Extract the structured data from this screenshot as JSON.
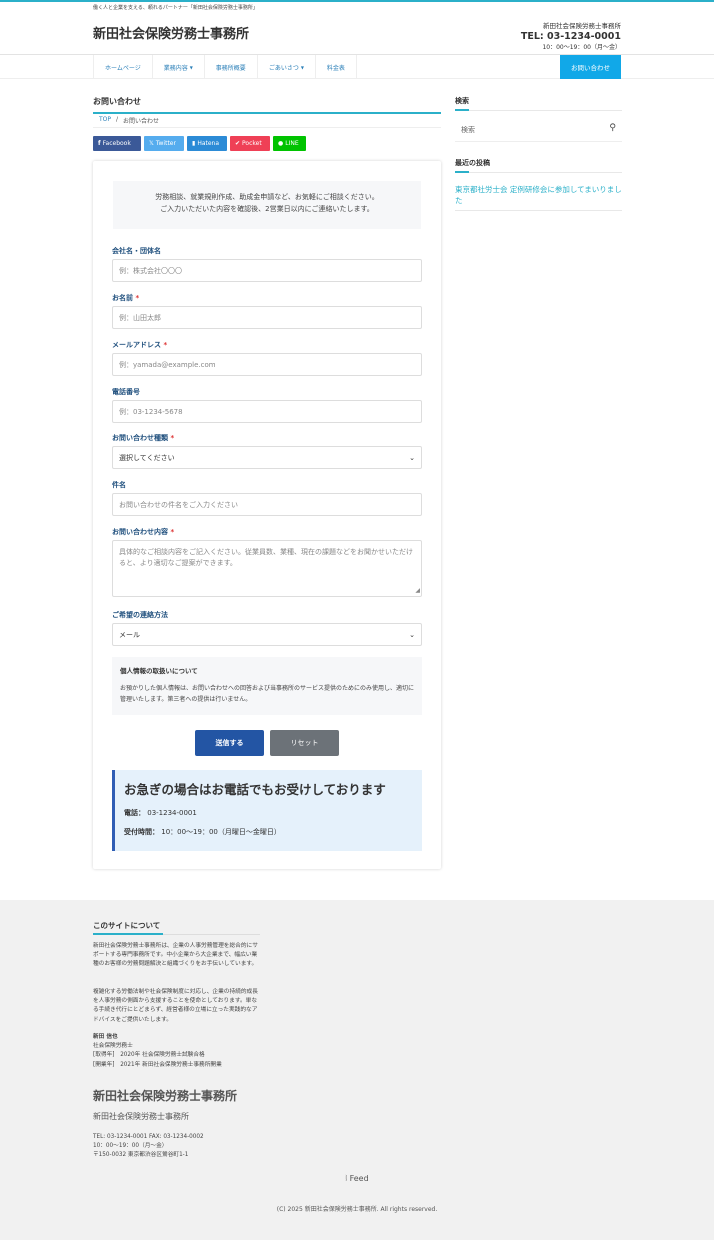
{
  "tagline": "働く人と企業を支える、頼れるパートナー「新田社会保険労務士事務所」",
  "header": {
    "site_title": "新田社会保険労務士事務所",
    "office_name": "新田社会保険労務士事務所",
    "tel": "TEL: 03-1234-0001",
    "hours": "10：00〜19：00（月〜金）"
  },
  "nav": {
    "items": [
      {
        "label": "ホームページ",
        "caret": ""
      },
      {
        "label": "業務内容",
        "caret": "▼"
      },
      {
        "label": "事務所概要",
        "caret": ""
      },
      {
        "label": "ごあいさつ",
        "caret": "▼"
      },
      {
        "label": "料金表",
        "caret": ""
      }
    ],
    "cta": "お問い合わせ"
  },
  "page": {
    "title": "お問い合わせ",
    "breadcrumb": {
      "top": "TOP",
      "sep": "/",
      "current": "お問い合わせ"
    }
  },
  "share": {
    "facebook": "Facebook",
    "twitter": "Twitter",
    "hatena": "Hatena",
    "pocket": "Pocket",
    "line": "LINE"
  },
  "form": {
    "intro_line1": "労務相談、就業規則作成、助成金申請など、お気軽にご相談ください。",
    "intro_line2": "ご入力いただいた内容を確認後、2営業日以内にご連絡いたします。",
    "required_mark": "*",
    "company": {
      "label": "会社名・団体名",
      "placeholder": "例：株式会社〇〇〇"
    },
    "name": {
      "label": "お名前",
      "placeholder": "例：山田太郎"
    },
    "email": {
      "label": "メールアドレス",
      "placeholder": "例：yamada@example.com"
    },
    "phone": {
      "label": "電話番号",
      "placeholder": "例：03-1234-5678"
    },
    "type": {
      "label": "お問い合わせ種類",
      "value": "選択してください"
    },
    "subject": {
      "label": "件名",
      "placeholder": "お問い合わせの件名をご入力ください"
    },
    "content": {
      "label": "お問い合わせ内容",
      "placeholder": "具体的なご相談内容をご記入ください。従業員数、業種、現在の課題などをお聞かせいただけると、より適切なご提案ができます。"
    },
    "contact_method": {
      "label": "ご希望の連絡方法",
      "value": "メール"
    },
    "privacy": {
      "title": "個人情報の取扱いについて",
      "text": "お預かりした個人情報は、お問い合わせへの回答および当事務所のサービス提供のためにのみ使用し、適切に管理いたします。第三者への提供は行いません。"
    },
    "submit": "送信する",
    "reset": "リセット"
  },
  "urgent": {
    "title": "お急ぎの場合はお電話でもお受けしております",
    "tel_label": "電話：",
    "tel": "03-1234-0001",
    "hours_label": "受付時間：",
    "hours": "10：00〜19：00（月曜日〜金曜日）"
  },
  "sidebar": {
    "search_heading": "検索",
    "search_placeholder": "検索",
    "recent_heading": "最近の投稿",
    "recent_post": "東京都社労士会 定例研修会に参加してまいりました"
  },
  "footer": {
    "about_heading": "このサイトについて",
    "about_p1": "新田社会保険労務士事務所は、企業の人事労務管理を総合的にサポートする専門事務所です。中小企業から大企業まで、幅広い業種のお客様の労務問題解決と組織づくりをお手伝いしています。",
    "about_p2": "複雑化する労働法制や社会保険制度に対応し、企業の持続的成長を人事労務の側面から支援することを使命としております。単なる手続き代行にとどまらず、経営者様の立場に立った実践的なアドバイスをご提供いたします。",
    "person_name": "新田 信也",
    "person_title": "社会保険労務士",
    "person_line1": "[取得年]　2020年 社会保険労務士試験合格",
    "person_line2": "[開業年]　2021年 新田社会保険労務士事務所開業",
    "big_title": "新田社会保険労務士事務所",
    "sub_title": "新田社会保険労務士事務所",
    "contact1": "TEL: 03-1234-0001 FAX: 03-1234-0002",
    "contact2": "10：00〜19：00（月〜金）",
    "contact3": "〒150-0032 東京都渋谷区鶯谷町1-1",
    "feed": "Feed",
    "copyright": "(C) 2025 新田社会保険労務士事務所. All rights reserved."
  },
  "colors": {
    "accent": "#2bb0c9",
    "cta": "#11a8e8",
    "submit": "#2355a4",
    "reset": "#6c7278",
    "label": "#1f4f7d"
  }
}
